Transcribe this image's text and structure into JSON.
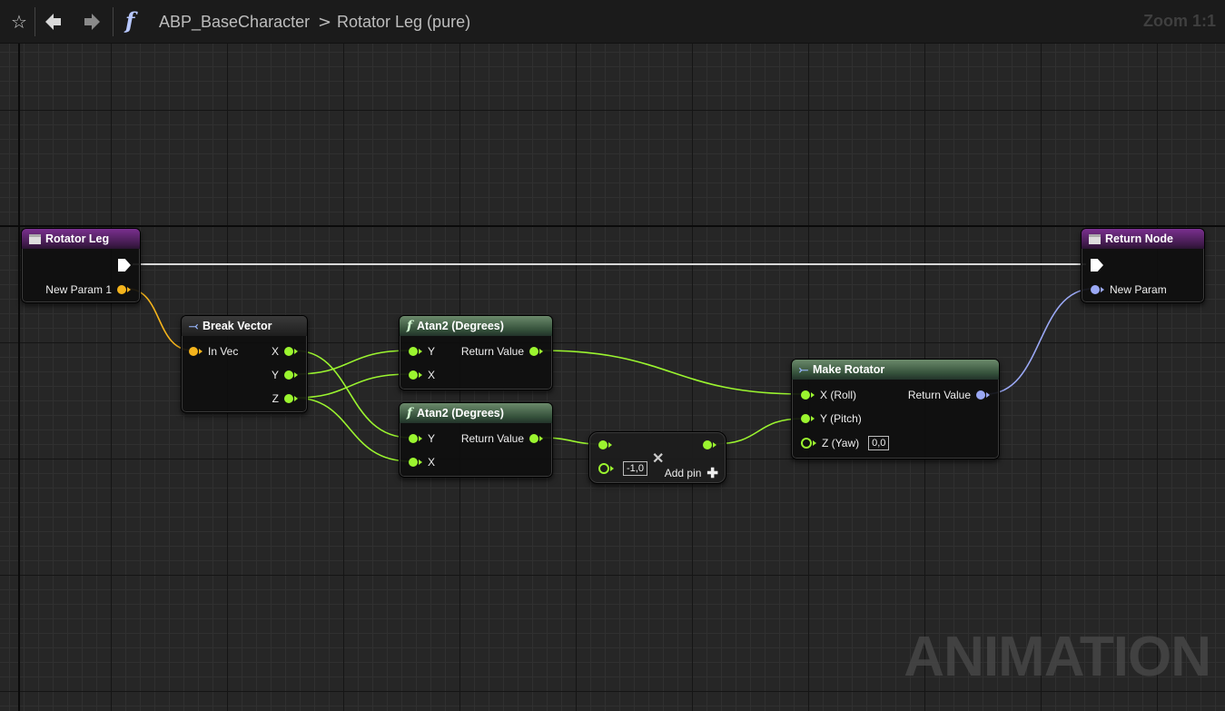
{
  "toolbar": {
    "favorite_icon": "star-icon",
    "back_icon": "arrow-left-icon",
    "forward_icon": "arrow-right-icon",
    "function_icon": "f",
    "breadcrumb_parent": "ABP_BaseCharacter",
    "breadcrumb_separator": ">",
    "breadcrumb_current": "Rotator Leg (pure)",
    "zoom": "Zoom 1:1"
  },
  "watermark": "ANIMATION",
  "nodes": {
    "entry": {
      "title": "Rotator Leg",
      "pin_param": "New Param 1"
    },
    "break_vector": {
      "title": "Break Vector",
      "pin_in": "In Vec",
      "pin_x": "X",
      "pin_y": "Y",
      "pin_z": "Z"
    },
    "atan_top": {
      "title": "Atan2 (Degrees)",
      "pin_y": "Y",
      "pin_x": "X",
      "pin_return": "Return Value"
    },
    "atan_bottom": {
      "title": "Atan2 (Degrees)",
      "pin_y": "Y",
      "pin_x": "X",
      "pin_return": "Return Value"
    },
    "multiply": {
      "value": "-1,0",
      "add_pin": "Add pin"
    },
    "make_rotator": {
      "title": "Make Rotator",
      "pin_roll": "X (Roll)",
      "pin_pitch": "Y (Pitch)",
      "pin_yaw": "Z (Yaw)",
      "yaw_value": "0,0",
      "pin_return": "Return Value"
    },
    "return_node": {
      "title": "Return Node",
      "pin_param": "New Param"
    }
  },
  "colors": {
    "float_pin": "#9bf52f",
    "vector_pin": "#f5b41c",
    "rotator_pin": "#9aa8f5",
    "entry_header": "#7a2f8f",
    "function_header": "#34503a"
  }
}
